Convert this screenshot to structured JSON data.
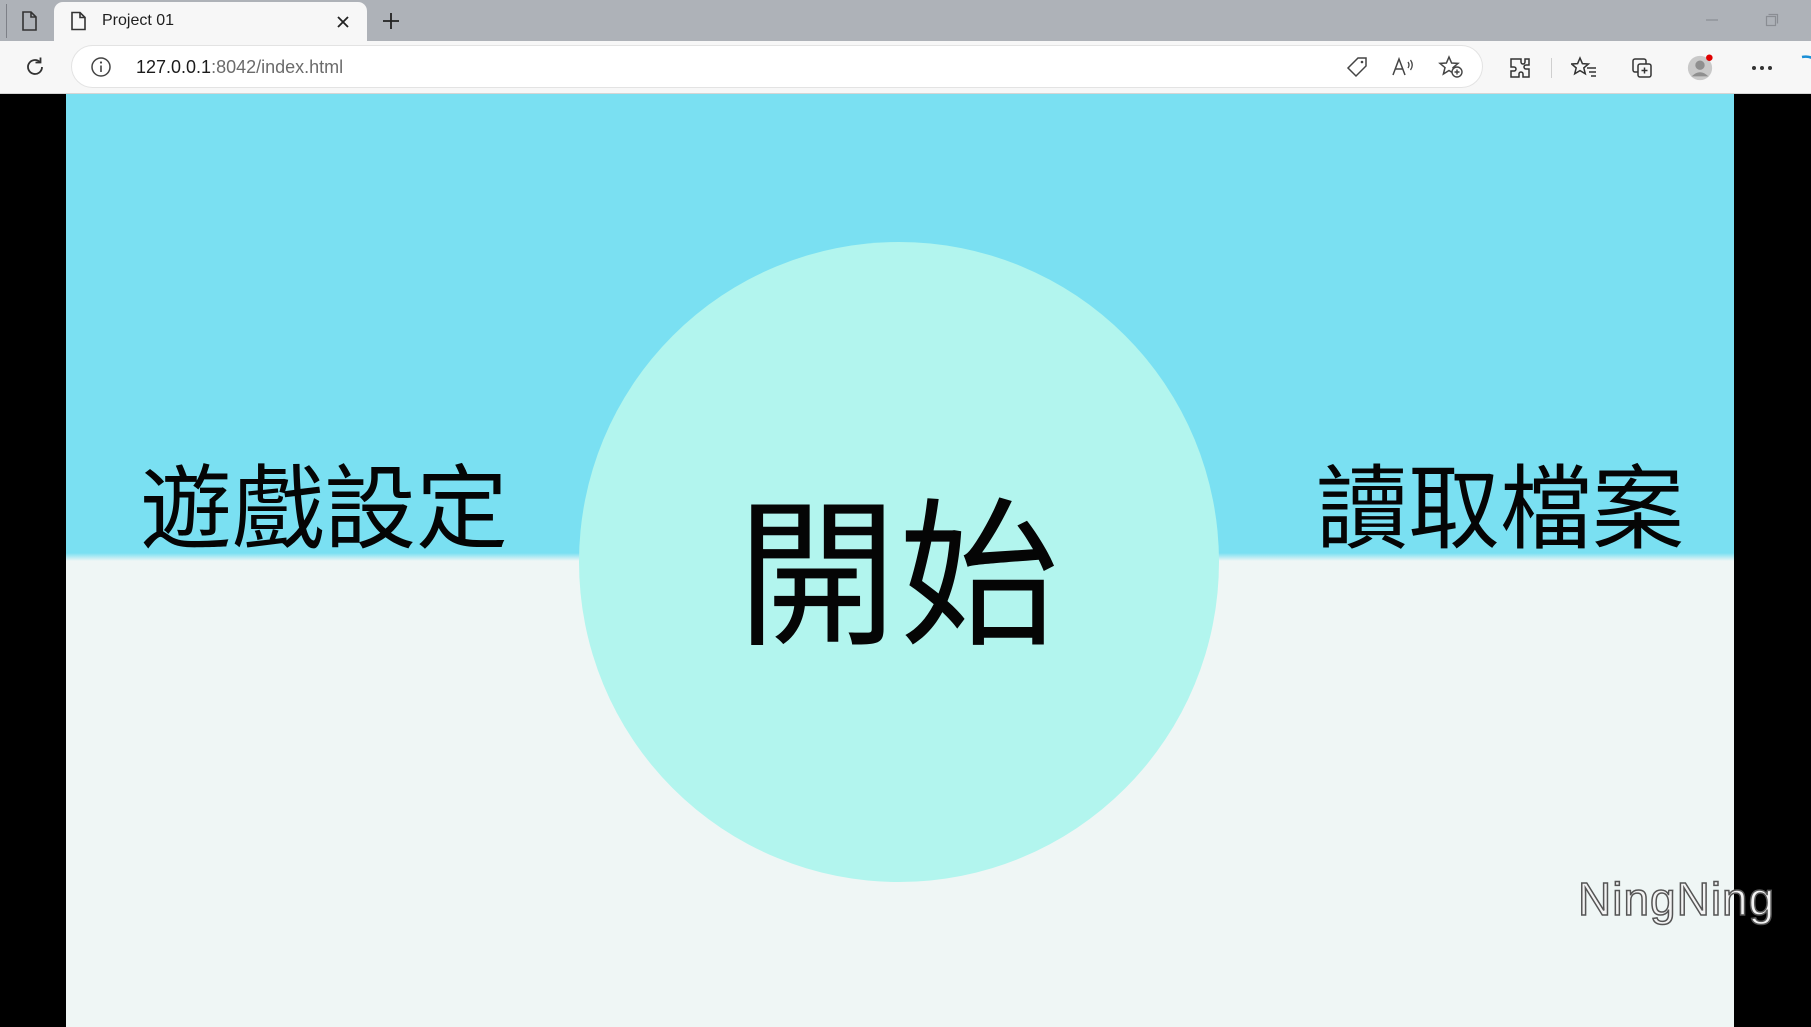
{
  "browser": {
    "tab": {
      "title": "Project 01",
      "icon": "page-icon",
      "close_icon": "close-icon"
    },
    "new_tab_icon": "plus-icon",
    "window_controls": [
      "minimize-icon",
      "restore-icon"
    ],
    "address_bar": {
      "url_host": "127.0.0.1",
      "url_rest": ":8042/index.html",
      "left_icon": "info-icon",
      "right_icons": [
        "tag-icon",
        "read-aloud-icon",
        "add-favorite-icon"
      ]
    },
    "toolbar_icons": [
      "extensions-icon",
      "favorites-icon",
      "collections-icon",
      "profile-icon",
      "more-icon"
    ]
  },
  "game": {
    "colors": {
      "sky": "#7ae0f2",
      "ground": "#eff6f5",
      "circle": "#b2f5ee",
      "text": "#050505"
    },
    "menu": {
      "settings_label": "遊戲設定",
      "start_label": "開始",
      "load_label": "讀取檔案"
    }
  },
  "watermark": "NingNing"
}
